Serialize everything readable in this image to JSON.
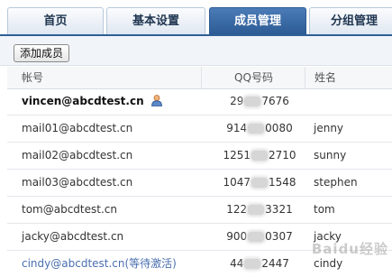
{
  "tabs": [
    {
      "label": "首页",
      "active": false
    },
    {
      "label": "基本设置",
      "active": false
    },
    {
      "label": "成员管理",
      "active": true
    },
    {
      "label": "分组管理",
      "active": false
    }
  ],
  "toolbar": {
    "add_member_label": "添加成员"
  },
  "table": {
    "headers": {
      "account": "帐号",
      "qq": "QQ号码",
      "name": "姓名"
    },
    "rows": [
      {
        "account": "vincen@abcdtest.cn",
        "qq_start": "29",
        "qq_end": "7676",
        "name": "",
        "admin": true
      },
      {
        "account": "mail01@abcdtest.cn",
        "qq_start": "914",
        "qq_end": "0080",
        "name": "jenny"
      },
      {
        "account": "mail02@abcdtest.cn",
        "qq_start": "1251",
        "qq_end": "2710",
        "name": "sunny"
      },
      {
        "account": "mail03@abcdtest.cn",
        "qq_start": "1047",
        "qq_end": "1548",
        "name": "stephen"
      },
      {
        "account": "tom@abcdtest.cn",
        "qq_start": "122",
        "qq_end": "3321",
        "name": "tom"
      },
      {
        "account": "jacky@abcdtest.cn",
        "qq_start": "900",
        "qq_end": "0307",
        "name": "jacky"
      },
      {
        "account": "cindy@abcdtest.cn(等待激活)",
        "qq_start": "44",
        "qq_end": "2447",
        "name": "cindy",
        "pending": true
      }
    ]
  },
  "watermark": "Baidu经验",
  "colors": {
    "tab_active": "#2c5b94",
    "pending_text": "#4a6fb0"
  }
}
